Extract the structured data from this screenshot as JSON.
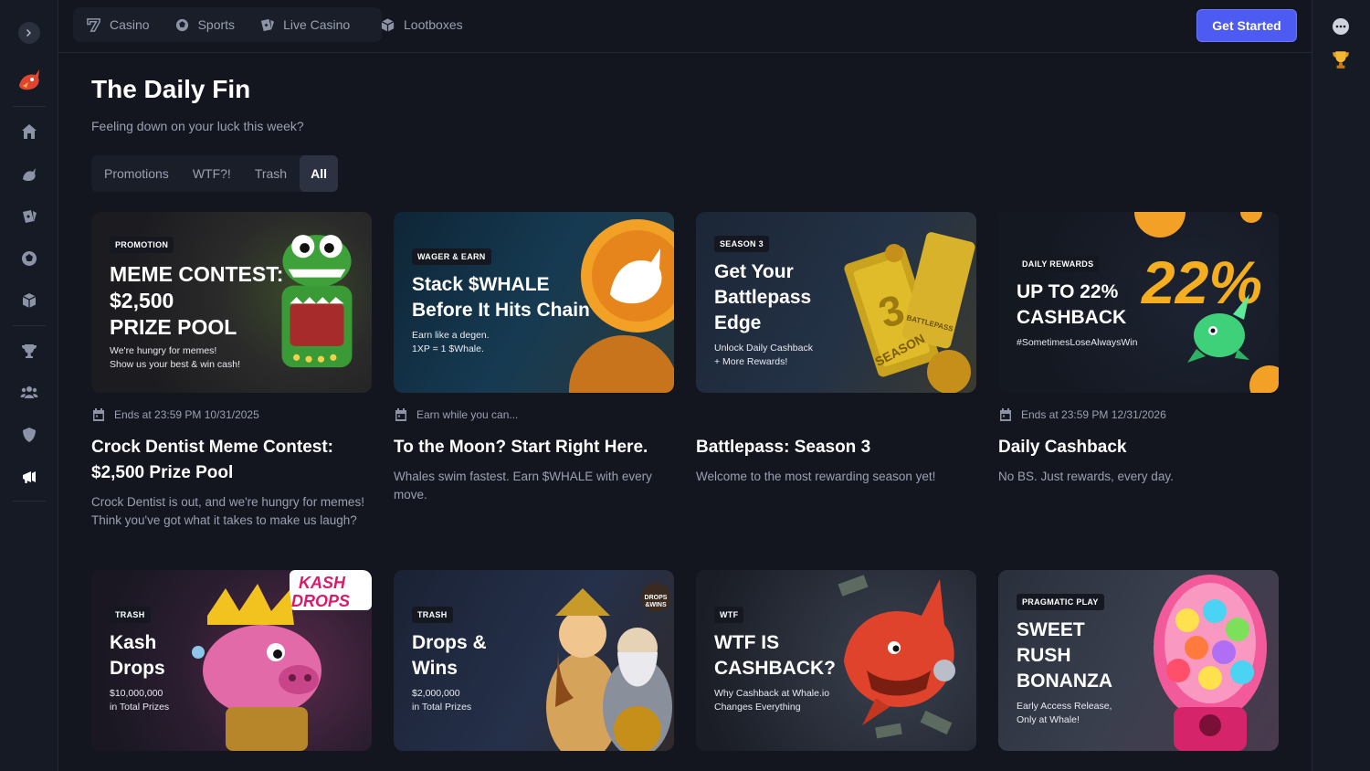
{
  "topnav": {
    "links": [
      "Casino",
      "Sports",
      "Live Casino"
    ],
    "lootboxes": "Lootboxes",
    "cta": "Get Started"
  },
  "page": {
    "title": "The Daily Fin",
    "subtitle": "Feeling down on your luck this week?"
  },
  "tabs": [
    "Promotions",
    "WTF?!",
    "Trash",
    "All"
  ],
  "active_tab": "All",
  "cards": [
    {
      "tag": "PROMOTION",
      "headline": [
        "MEME CONTEST:",
        "$2,500",
        "PRIZE POOL"
      ],
      "small": [
        "We're hungry for memes!",
        "Show us your best & win cash!"
      ],
      "meta": "Ends at 23:59 PM 10/31/2025",
      "title": "Crock Dentist Meme Contest: $2,500 Prize Pool",
      "description": "Crock Dentist is out, and we're hungry for memes! Think you've got what it takes to make us laugh?"
    },
    {
      "tag": "WAGER & EARN",
      "headline": [
        "Stack $WHALE",
        "Before It Hits Chain"
      ],
      "small": [
        "Earn like a degen.",
        "1XP = 1 $Whale."
      ],
      "meta": "Earn while you can...",
      "title": "To the Moon? Start Right Here.",
      "description": "Whales swim fastest. Earn $WHALE with every move."
    },
    {
      "tag": "SEASON 3",
      "headline": [
        "Get Your",
        "Battlepass",
        "Edge"
      ],
      "small": [
        "Unlock Daily Cashback",
        "+ More Rewards!"
      ],
      "art_text": [
        "3",
        "BATTLEPASS",
        "SEASON"
      ],
      "meta": "",
      "title": "Battlepass: Season 3",
      "description": "Welcome to the most rewarding season yet!"
    },
    {
      "tag": "DAILY REWARDS",
      "headline": [
        "UP TO 22%",
        "CASHBACK"
      ],
      "small": [
        "#SometimesLoseAlwaysWin"
      ],
      "art_text": "22%",
      "meta": "Ends at 23:59 PM 12/31/2026",
      "title": "Daily Cashback",
      "description": "No BS. Just rewards, every day."
    },
    {
      "tag": "TRASH",
      "headline": [
        "Kash",
        "Drops"
      ],
      "small": [
        "$10,000,000",
        "in Total Prizes"
      ],
      "logo_text": [
        "KASH",
        "DROPS"
      ]
    },
    {
      "tag": "TRASH",
      "headline": [
        "Drops &",
        "Wins"
      ],
      "small": [
        "$2,000,000",
        "in Total Prizes"
      ],
      "logo_text": [
        "DROPS",
        "&WINS"
      ]
    },
    {
      "tag": "WTF",
      "headline": [
        "WTF IS",
        "CASHBACK?"
      ],
      "small": [
        "Why Cashback at Whale.io",
        "Changes Everything"
      ]
    },
    {
      "tag": "PRAGMATIC PLAY",
      "headline": [
        "SWEET",
        "RUSH",
        "BONANZA"
      ],
      "small": [
        "Early Access Release,",
        "Only at Whale!"
      ]
    }
  ],
  "colors": {
    "background": "#13161f",
    "panel": "#1a1e29",
    "cta": "#4d5bf2",
    "muted_text": "#9aa0b2"
  }
}
